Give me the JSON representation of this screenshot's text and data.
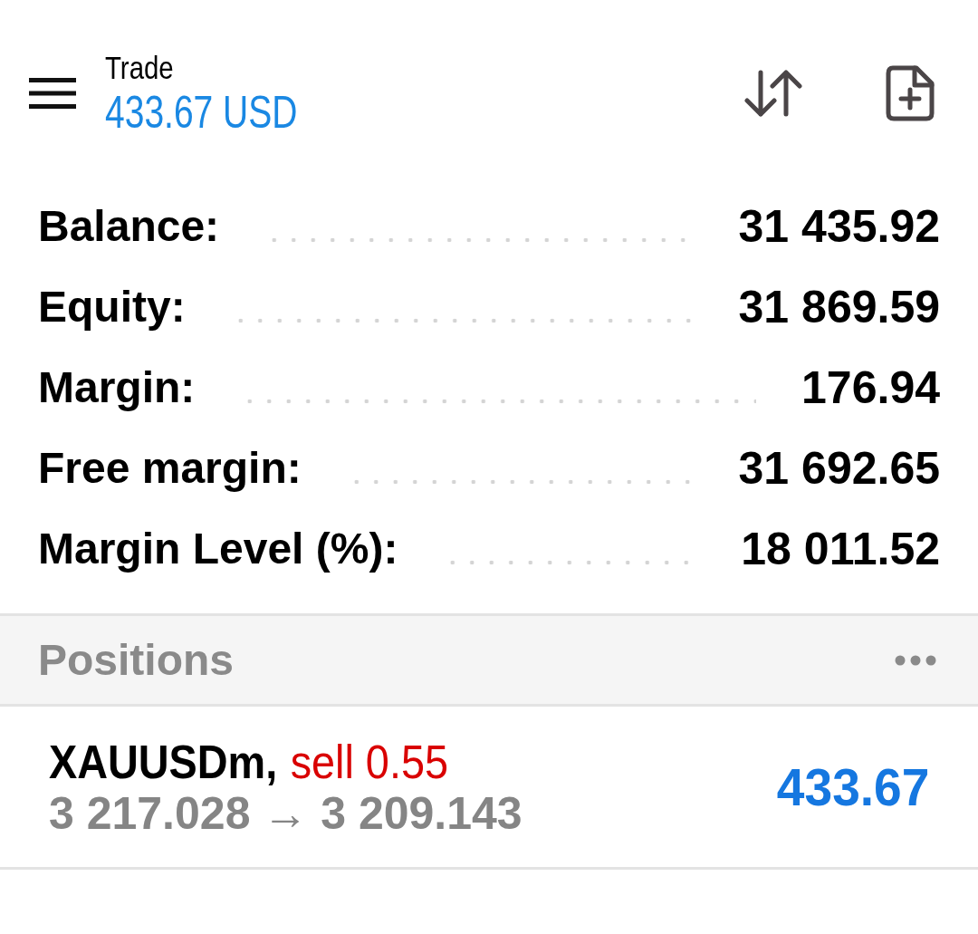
{
  "header": {
    "title": "Trade",
    "profit": "433.67 USD"
  },
  "account": [
    {
      "label": "Balance:",
      "value": "31 435.92"
    },
    {
      "label": "Equity:",
      "value": "31 869.59"
    },
    {
      "label": "Margin:",
      "value": "176.94"
    },
    {
      "label": "Free margin:",
      "value": "31 692.65"
    },
    {
      "label": "Margin Level (%):",
      "value": "18 011.52"
    }
  ],
  "positions": {
    "title": "Positions",
    "items": [
      {
        "symbol": "XAUUSDm,",
        "kind": "sell",
        "order": "sell 0.55",
        "prices": "3 217.028 → 3 209.143",
        "profit": "433.67"
      }
    ]
  }
}
